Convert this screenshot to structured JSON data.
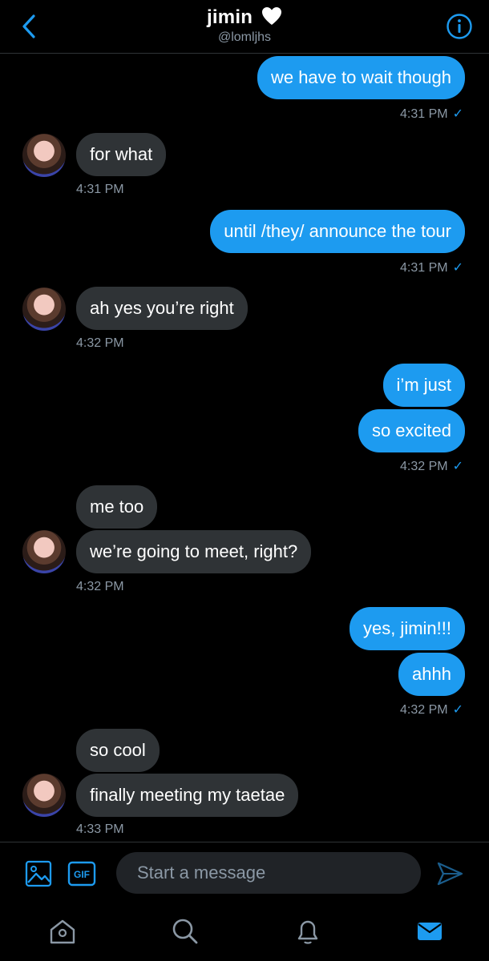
{
  "header": {
    "name": "jimin",
    "handle": "@lomljhs"
  },
  "messages": {
    "m1": {
      "text": "we have to wait though",
      "time": "4:31 PM"
    },
    "m2": {
      "text": "for what",
      "time": "4:31 PM"
    },
    "m3": {
      "text": "until /they/ announce the tour",
      "time": "4:31 PM"
    },
    "m4": {
      "text": "ah yes you’re right",
      "time": "4:32 PM"
    },
    "m5a": {
      "text": "i’m just"
    },
    "m5b": {
      "text": "so excited",
      "time": "4:32 PM"
    },
    "m6a": {
      "text": "me too"
    },
    "m6b": {
      "text": "we’re going to meet, right?",
      "time": "4:32 PM"
    },
    "m7a": {
      "text": "yes, jimin!!!"
    },
    "m7b": {
      "text": "ahhh",
      "time": "4:32 PM"
    },
    "m8a": {
      "text": "so cool"
    },
    "m8b": {
      "text": "finally meeting my taetae",
      "time": "4:33 PM"
    }
  },
  "composer": {
    "placeholder": "Start a message"
  },
  "colors": {
    "accent": "#1d9bf0",
    "incoming": "#2f3336",
    "background": "#000000"
  }
}
